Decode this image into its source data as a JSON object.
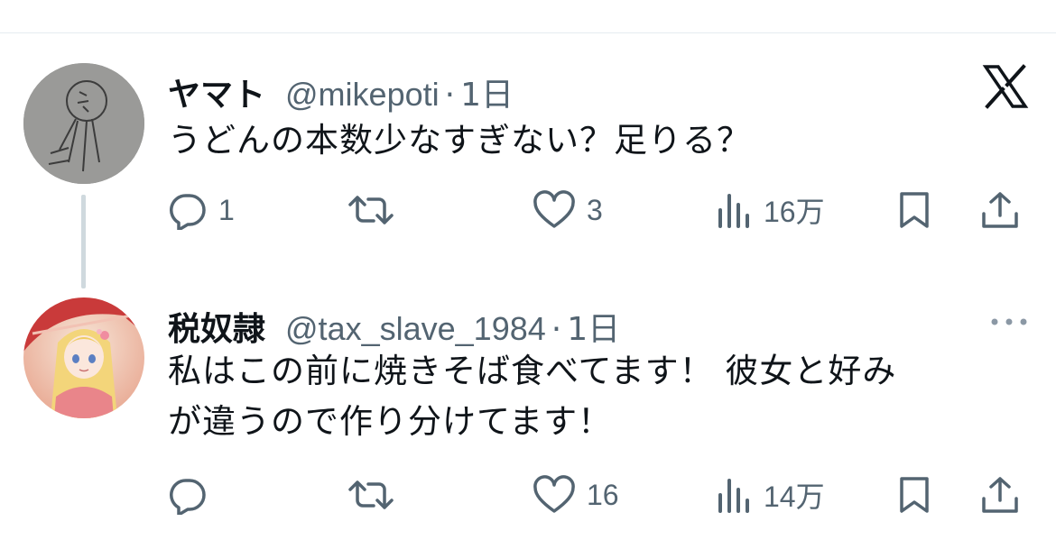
{
  "tweets": [
    {
      "display_name": "ヤマト",
      "handle": "@mikepoti",
      "separator": "·",
      "time": "1日",
      "text": "うどんの本数少なすぎない？足りる？",
      "avatar_icon": "sketch-face-avatar",
      "corner_icon": "x-logo-icon",
      "reply_count": "1",
      "retweet_count": "",
      "like_count": "3",
      "view_count": "16万"
    },
    {
      "display_name": "税奴隷",
      "handle": "@tax_slave_1984",
      "separator": "·",
      "time": "1日",
      "text_line1": "私はこの前に焼きそば食べてます！ 彼女と好み",
      "text_line2": "が違うので作り分けてます！",
      "avatar_icon": "anime-girl-avatar",
      "corner_icon": "more-dots-icon",
      "reply_count": "",
      "retweet_count": "",
      "like_count": "16",
      "view_count": "14万"
    }
  ],
  "colors": {
    "text_primary": "#0f1419",
    "text_secondary": "#536471",
    "thread_line": "#cfd9de",
    "divider": "#e6ecf0"
  }
}
